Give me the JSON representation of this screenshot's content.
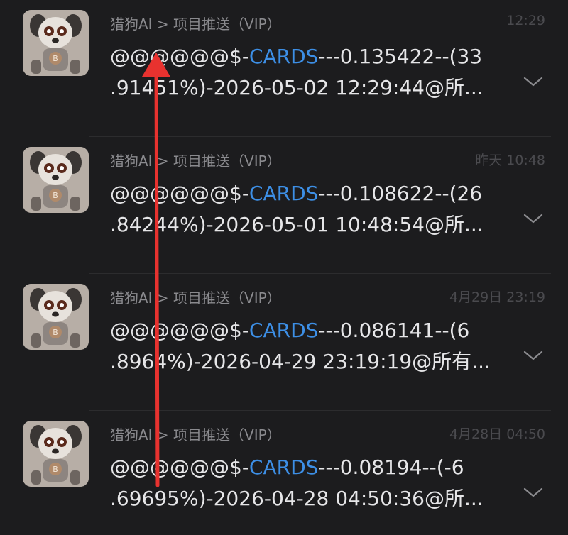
{
  "messages": [
    {
      "sender": "猎狗AI > 项目推送（VIP）",
      "time": "12:29",
      "prefix": "@@@@@@$-",
      "ticker": "CARDS",
      "line1_rest": "---0.135422--(33",
      "line2": ".91451%)-2026-05-02 12:29:44@所..."
    },
    {
      "sender": "猎狗AI > 项目推送（VIP）",
      "time": "昨天 10:48",
      "prefix": "@@@@@@$-",
      "ticker": "CARDS",
      "line1_rest": "---0.108622--(26",
      "line2": ".84244%)-2026-05-01 10:48:54@所..."
    },
    {
      "sender": "猎狗AI > 项目推送（VIP）",
      "time": "4月29日 23:19",
      "prefix": "@@@@@@$-",
      "ticker": "CARDS",
      "line1_rest": "---0.086141--(6",
      "line2": ".8964%)-2026-04-29 23:19:19@所有..."
    },
    {
      "sender": "猎狗AI > 项目推送（VIP）",
      "time": "4月28日 04:50",
      "prefix": "@@@@@@$-",
      "ticker": "CARDS",
      "line1_rest": "---0.08194--(-6",
      "line2": ".69695%)-2026-04-28 04:50:36@所..."
    }
  ],
  "icons": {
    "avatar": "robot-dog-avatar-icon",
    "expand": "chevron-down-icon",
    "annotation": "red-up-arrow-annotation"
  },
  "colors": {
    "background": "#1c1c1e",
    "ticker": "#3d8fe6",
    "annotation": "#e8322f"
  }
}
